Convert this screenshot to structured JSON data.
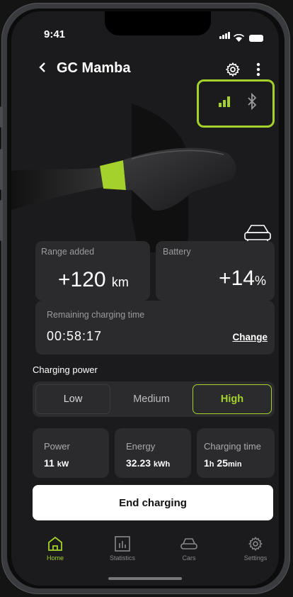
{
  "status_bar": {
    "time": "9:41"
  },
  "header": {
    "back_icon": "chevron-left-icon",
    "title": "GC Mamba",
    "settings_icon": "gear-icon",
    "more_icon": "more-vertical-icon"
  },
  "connectivity": {
    "signal_icon": "signal-bars-icon",
    "bluetooth_icon": "bluetooth-icon",
    "accent_color": "#a4d12b"
  },
  "range_card": {
    "label": "Range added",
    "value": "+120",
    "unit": "km"
  },
  "battery_card": {
    "label": "Battery",
    "value": "+14",
    "unit": "%"
  },
  "remaining": {
    "label": "Remaining charging time",
    "value": "00:58:17",
    "change_label": "Change"
  },
  "charging_power": {
    "label": "Charging power",
    "options": [
      "Low",
      "Medium",
      "High"
    ],
    "selected": "High"
  },
  "stats": [
    {
      "label": "Power",
      "value": "11",
      "unit": "kW"
    },
    {
      "label": "Energy",
      "value": "32.23",
      "unit": "kWh"
    },
    {
      "label": "Charging time",
      "value_h": "1",
      "unit_h": "h",
      "value_m": "25",
      "unit_m": "min"
    }
  ],
  "end_button": "End charging",
  "tabs": [
    {
      "label": "Home",
      "icon": "home-icon",
      "active": true
    },
    {
      "label": "Statistics",
      "icon": "chart-icon",
      "active": false
    },
    {
      "label": "Cars",
      "icon": "car-icon",
      "active": false
    },
    {
      "label": "Settings",
      "icon": "gear-icon",
      "active": false
    }
  ],
  "colors": {
    "accent": "#a4d12b",
    "card": "#2b2b2d",
    "background": "#1b1b1d"
  }
}
